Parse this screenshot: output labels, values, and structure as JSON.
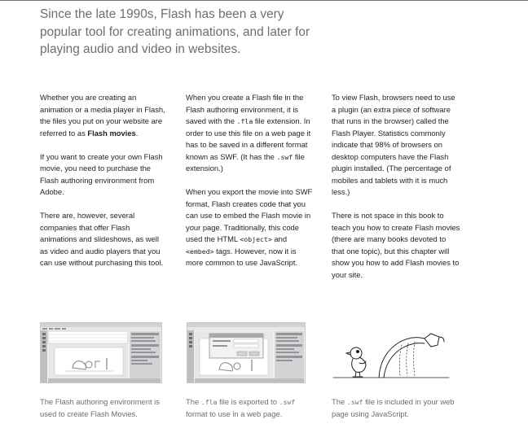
{
  "lead": "Since the late 1990s, Flash has been a very popular tool for creating animations, and later for playing audio and video in websites.",
  "col1": {
    "p1_a": "Whether you are creating an animation or a media player in Flash, the files you put on your website are referred to as ",
    "p1_bold": "Flash movies",
    "p1_end": ".",
    "p2": "If you want to create your own Flash movie, you need to purchase the Flash authoring environment from Adobe.",
    "p3": "There are, however, several companies that offer Flash animations and slideshows, as well as video and audio players that you can use without purchasing this tool."
  },
  "col2": {
    "p1_a": "When you create a Flash file in the Flash authoring environment, it is saved with the ",
    "p1_code1": ".fla",
    "p1_b": " file extension. In order to use this file on a web page it has to be saved in a different format known as SWF. (It has the ",
    "p1_code2": ".swf",
    "p1_c": " file extension.)",
    "p2_a": "When you export the movie into SWF format, Flash creates code that you can use to embed the Flash movie in your page. Traditionally, this code used the HTML ",
    "p2_code1": "<object>",
    "p2_b": " and ",
    "p2_code2": "<embed>",
    "p2_c": " tags. However, now it is more common to use JavaScript."
  },
  "col3": {
    "p1": "To view Flash, browsers need to use a plugin (an extra piece of software that runs in the browser) called the Flash Player. Statistics commonly indicate that 98% of browsers on desktop computers have the Flash plugin installed. (The percentage of mobiles and tablets with it is much less.)",
    "p2": "There is not space in this book to teach you how to create Flash movies (there are many books devoted to that one topic), but this chapter will show you how to add Flash movies to your site."
  },
  "captions": {
    "c1": "The Flash authoring environment is used to create Flash Movies.",
    "c2_a": "The ",
    "c2_code1": ".fla",
    "c2_b": " file is exported to ",
    "c2_code2": ".swf",
    "c2_c": " format to use in a web page.",
    "c3_a": "The ",
    "c3_code": ".swf",
    "c3_b": " file is included in your web page using JavaScript."
  },
  "colors": {
    "text": "#231f20",
    "grey": "#6d6e71"
  },
  "images": {
    "fig1": "flash-authoring-screenshot",
    "fig2": "flash-export-dialog-screenshot",
    "fig3": "bird-watering-can-illustration"
  }
}
